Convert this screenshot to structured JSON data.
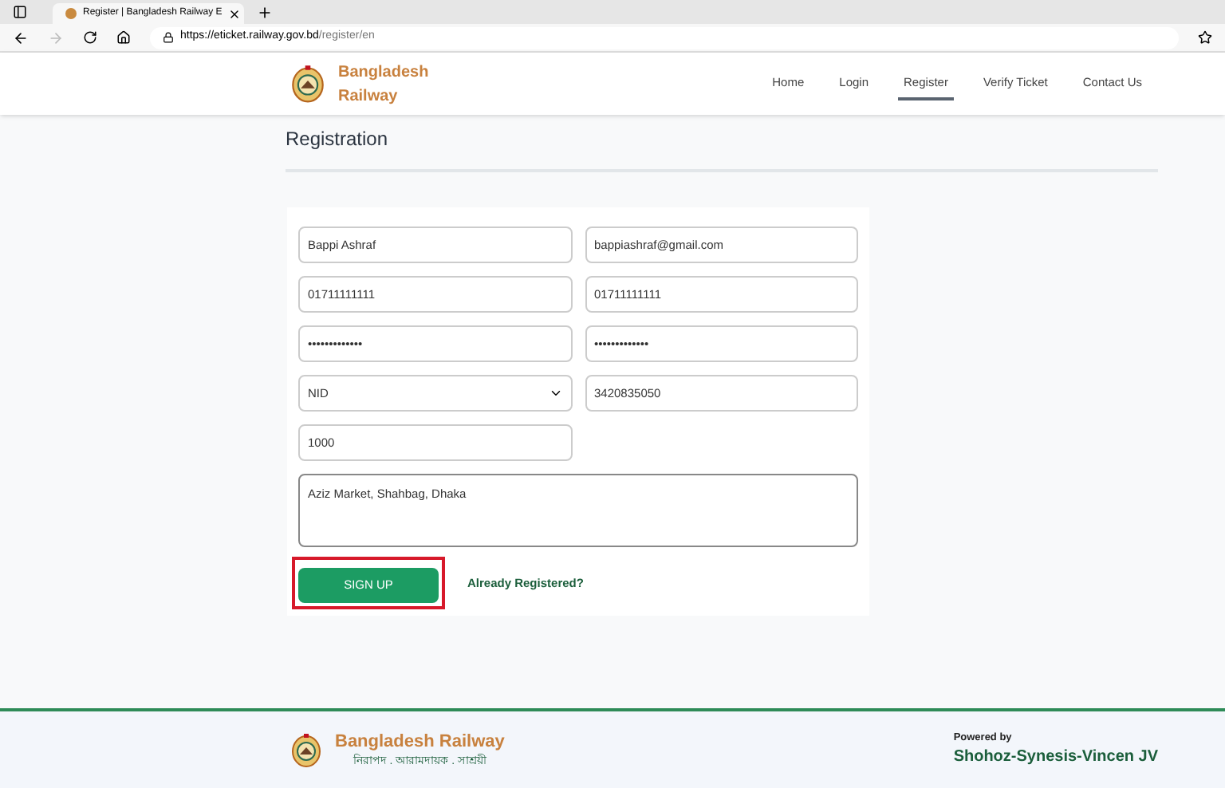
{
  "browser": {
    "tab_title": "Register | Bangladesh Railway E",
    "url_host": "https://eticket.railway.gov.bd",
    "url_path": "/register/en"
  },
  "header": {
    "brand": [
      "Bangladesh",
      "Railway"
    ],
    "nav": [
      {
        "label": "Home",
        "selected": false
      },
      {
        "label": "Login",
        "selected": false
      },
      {
        "label": "Register",
        "selected": true
      },
      {
        "label": "Verify Ticket",
        "selected": false
      },
      {
        "label": "Contact Us",
        "selected": false
      }
    ]
  },
  "page_title": "Registration",
  "form": {
    "fields": [
      {
        "kind": "text",
        "value": "Bappi Ashraf"
      },
      {
        "kind": "text",
        "value": "bappiashraf@gmail.com"
      },
      {
        "kind": "text",
        "value": "01711111111"
      },
      {
        "kind": "text",
        "value": "01711111111"
      },
      {
        "kind": "text",
        "value": "•••••••••••••"
      },
      {
        "kind": "text",
        "value": "•••••••••••••"
      },
      {
        "kind": "select",
        "value": "NID"
      },
      {
        "kind": "text",
        "value": "3420835050"
      },
      {
        "kind": "text",
        "value": "1000"
      },
      {
        "kind": "textarea",
        "value": "Aziz Market, Shahbag, Dhaka"
      }
    ],
    "submit": {
      "label": "SIGN UP",
      "highlighted": true
    },
    "login_link": "Already Registered?"
  },
  "footer": {
    "brand": "Bangladesh Railway",
    "tagline": "নিরাপদ . আরামদায়ক . সাশ্রয়ী",
    "powered_by": "Powered by",
    "company": "Shohoz-Synesis-Vincen JV"
  }
}
